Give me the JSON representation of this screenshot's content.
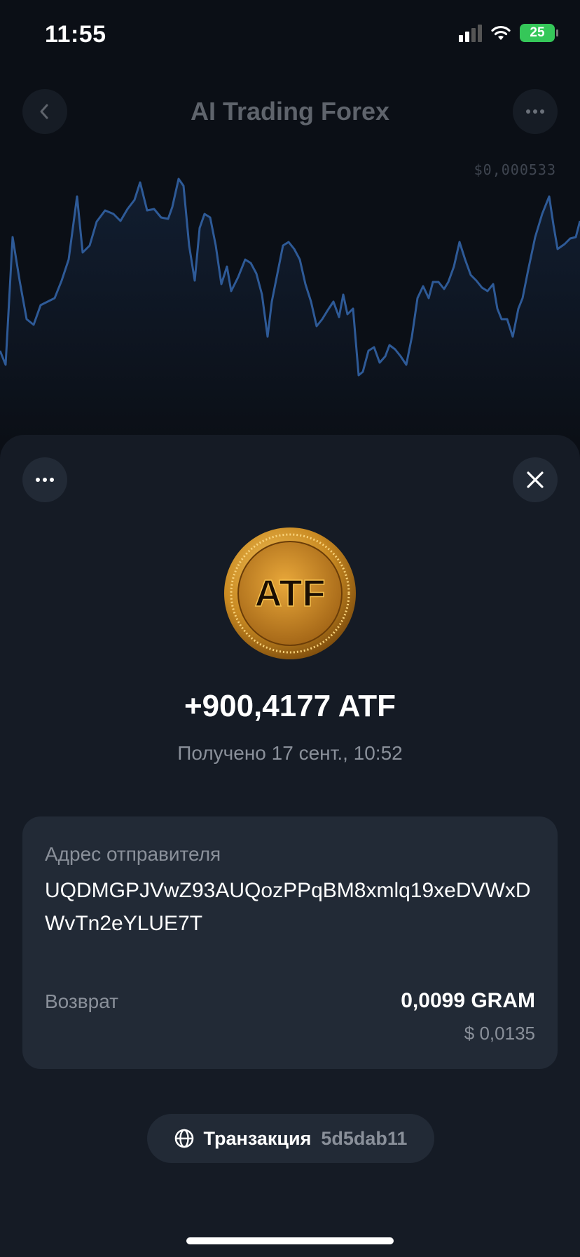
{
  "status_bar": {
    "time": "11:55",
    "battery": "25"
  },
  "header": {
    "title": "AI Trading Forex",
    "back_icon": "chevron-left-icon",
    "more_icon": "ellipsis-icon"
  },
  "chart": {
    "price": "$0,000533",
    "line_color": "#2e5a97"
  },
  "sheet": {
    "coin_text": "ATF",
    "amount": "+900,4177 ATF",
    "subtitle": "Получено 17 сент., 10:52",
    "sender_label": "Адрес отправителя",
    "sender_address": "UQDMGPJVwZ93AUQozPPqBM8xmlq19xeDVWxDWvTn2eYLUE7T",
    "refund_label": "Возврат",
    "refund_amount": "0,0099 GRAM",
    "refund_usd": "$ 0,0135",
    "tx_label": "Транзакция",
    "tx_hash": "5d5dab11"
  }
}
